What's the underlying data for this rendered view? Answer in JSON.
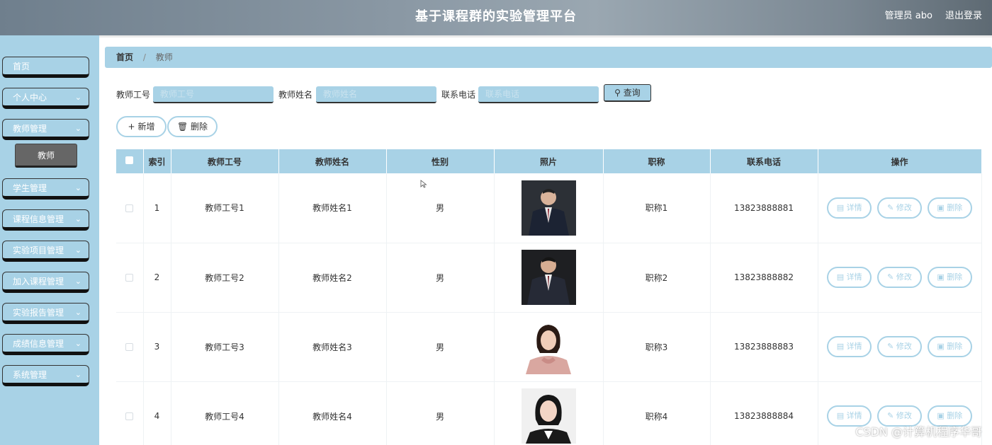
{
  "header": {
    "title": "基于课程群的实验管理平台",
    "admin_label": "管理员 abo",
    "logout_label": "退出登录"
  },
  "sidebar": {
    "items": [
      {
        "label": "首页"
      },
      {
        "label": "个人中心"
      },
      {
        "label": "教师管理"
      },
      {
        "label": "学生管理"
      },
      {
        "label": "课程信息管理"
      },
      {
        "label": "实验项目管理"
      },
      {
        "label": "加入课程管理"
      },
      {
        "label": "实验报告管理"
      },
      {
        "label": "成绩信息管理"
      },
      {
        "label": "系统管理"
      }
    ],
    "submenu_active": "教师"
  },
  "breadcrumb": {
    "home": "首页",
    "current": "教师"
  },
  "search": {
    "teacher_no_label": "教师工号",
    "teacher_no_placeholder": "教师工号",
    "teacher_name_label": "教师姓名",
    "teacher_name_placeholder": "教师姓名",
    "phone_label": "联系电话",
    "phone_placeholder": "联系电话",
    "query_label": "查询"
  },
  "actions": {
    "add_label": "新增",
    "delete_label": "删除"
  },
  "table": {
    "headers": [
      "索引",
      "教师工号",
      "教师姓名",
      "性别",
      "照片",
      "职称",
      "联系电话",
      "操作"
    ],
    "rows": [
      {
        "index": "1",
        "teacher_no": "教师工号1",
        "teacher_name": "教师姓名1",
        "gender": "男",
        "title": "职称1",
        "phone": "13823888881"
      },
      {
        "index": "2",
        "teacher_no": "教师工号2",
        "teacher_name": "教师姓名2",
        "gender": "男",
        "title": "职称2",
        "phone": "13823888882"
      },
      {
        "index": "3",
        "teacher_no": "教师工号3",
        "teacher_name": "教师姓名3",
        "gender": "男",
        "title": "职称3",
        "phone": "13823888883"
      },
      {
        "index": "4",
        "teacher_no": "教师工号4",
        "teacher_name": "教师姓名4",
        "gender": "男",
        "title": "职称4",
        "phone": "13823888884"
      }
    ],
    "op_detail": "详情",
    "op_edit": "修改",
    "op_delete": "删除"
  },
  "watermark": "CSDN @计算机程序华哥",
  "colors": {
    "accent": "#a8d2e6",
    "header_bg": "#8a98a4"
  }
}
